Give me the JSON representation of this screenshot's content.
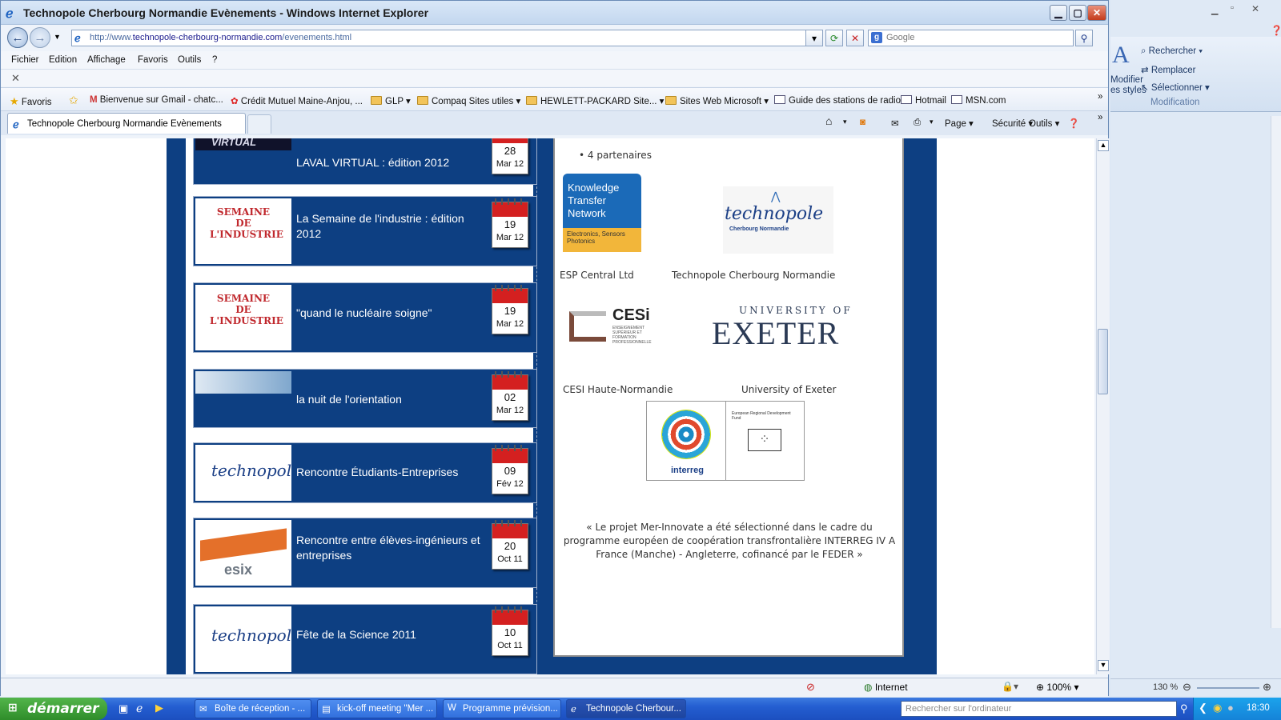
{
  "window": {
    "title": "Technopole Cherbourg Normandie Evènements - Windows Internet Explorer"
  },
  "address": {
    "prefix": "http://www.",
    "domain": "technopole-cherbourg-normandie.com",
    "path": "/evenements.html"
  },
  "search": {
    "placeholder": "Google"
  },
  "menu": [
    "Fichier",
    "Edition",
    "Affichage",
    "Favoris",
    "Outils",
    "?"
  ],
  "favorites": {
    "label": "Favoris",
    "items": [
      {
        "label": "Bienvenue sur Gmail - chatc...",
        "icon": "gmail-icon"
      },
      {
        "label": "Crédit Mutuel Maine-Anjou, ...",
        "icon": "credit-mutuel-icon"
      },
      {
        "label": "GLP",
        "icon": "folder-icon"
      },
      {
        "label": "Compaq Sites utiles",
        "icon": "folder-icon"
      },
      {
        "label": "HEWLETT-PACKARD Site...",
        "icon": "folder-icon"
      },
      {
        "label": "Sites Web Microsoft",
        "icon": "folder-icon"
      },
      {
        "label": "Guide des stations de radio",
        "icon": "page-icon"
      },
      {
        "label": "Hotmail",
        "icon": "page-icon"
      },
      {
        "label": "MSN.com",
        "icon": "page-icon"
      }
    ]
  },
  "tab": {
    "title": "Technopole Cherbourg Normandie Evènements"
  },
  "commands": {
    "page": "Page",
    "security": "Sécurité",
    "tools": "Outils"
  },
  "events": [
    {
      "title": "LAVAL VIRTUAL : édition 2012",
      "day": "28",
      "month": "Mar 12",
      "thumb": "VIRTUAL"
    },
    {
      "title": "La Semaine de l'industrie : édition 2012",
      "day": "19",
      "month": "Mar 12",
      "thumb": "SEMAINE DE L'INDUSTRIE"
    },
    {
      "title": "\"quand le nucléaire soigne\"",
      "day": "19",
      "month": "Mar 12",
      "thumb": "SEMAINE DE L'INDUSTRIE"
    },
    {
      "title": "la nuit de l'orientation",
      "day": "02",
      "month": "Mar 12",
      "thumb": ""
    },
    {
      "title": "Rencontre Étudiants-Entreprises",
      "day": "09",
      "month": "Fév 12",
      "thumb": "technopole"
    },
    {
      "title": "Rencontre entre élèves-ingénieurs et entreprises",
      "day": "20",
      "month": "Oct 11",
      "thumb": "esix"
    },
    {
      "title": "Fête de la Science 2011",
      "day": "10",
      "month": "Oct 11",
      "thumb": "technopole"
    }
  ],
  "partners": {
    "count": "4 partenaires",
    "ktn": {
      "line1": "Knowledge",
      "line2": "Transfer",
      "line3": "Network",
      "sub": "Electronics, Sensors Photonics"
    },
    "technopole_logo": "technopole",
    "technopole_sub": "Cherbourg Normandie",
    "cesi_logo": "CESi",
    "cesi_sub": "ENSEIGNEMENT SUPÉRIEUR ET FORMATION PROFESSIONNELLE",
    "exeter_top": "UNIVERSITY OF",
    "exeter_main": "EXETER",
    "names": [
      "ESP Central Ltd",
      "Technopole Cherbourg Normandie",
      "CESI Haute-Normandie",
      "University of Exeter"
    ],
    "interreg": "interreg",
    "erdf": "European Regional Development Fund",
    "quote": "« Le projet Mer-Innovate a été sélectionné dans le cadre du programme européen de coopération transfrontalière INTERREG IV A France (Manche) - Angleterre, cofinancé par le FEDER »"
  },
  "status": {
    "zone": "Internet",
    "zoom": "100%"
  },
  "word": {
    "search": "Rechercher",
    "replace": "Remplacer",
    "select": "Sélectionner",
    "group": "Modification",
    "styles1": "Modifier",
    "styles2": "es styles",
    "zoom": "130 %"
  },
  "taskbar": {
    "start": "démarrer",
    "items": [
      "Boîte de réception - ...",
      "kick-off meeting \"Mer ...",
      "Programme prévision...",
      "Technopole Cherbour..."
    ],
    "search": "Rechercher sur l'ordinateur",
    "clock": "18:30"
  }
}
